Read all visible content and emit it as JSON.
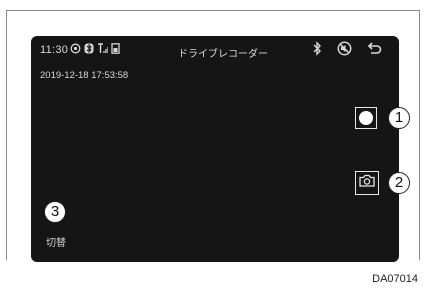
{
  "status_bar": {
    "time": "11:30",
    "icons": [
      "signal-icon",
      "bluetooth-status-icon",
      "antenna-icon",
      "phone-icon"
    ]
  },
  "header": {
    "title": "ドライブレコーダー",
    "icons": [
      "bluetooth-icon",
      "no-sound-icon",
      "back-icon"
    ]
  },
  "timestamp": "2019-12-18 17:53:58",
  "controls": {
    "record_button": {
      "icon": "record-icon",
      "callout": "1"
    },
    "photo_button": {
      "icon": "camera-icon",
      "callout": "2"
    },
    "switch_button": {
      "label": "切替",
      "callout": "3"
    }
  },
  "figure_code": "DA07014"
}
